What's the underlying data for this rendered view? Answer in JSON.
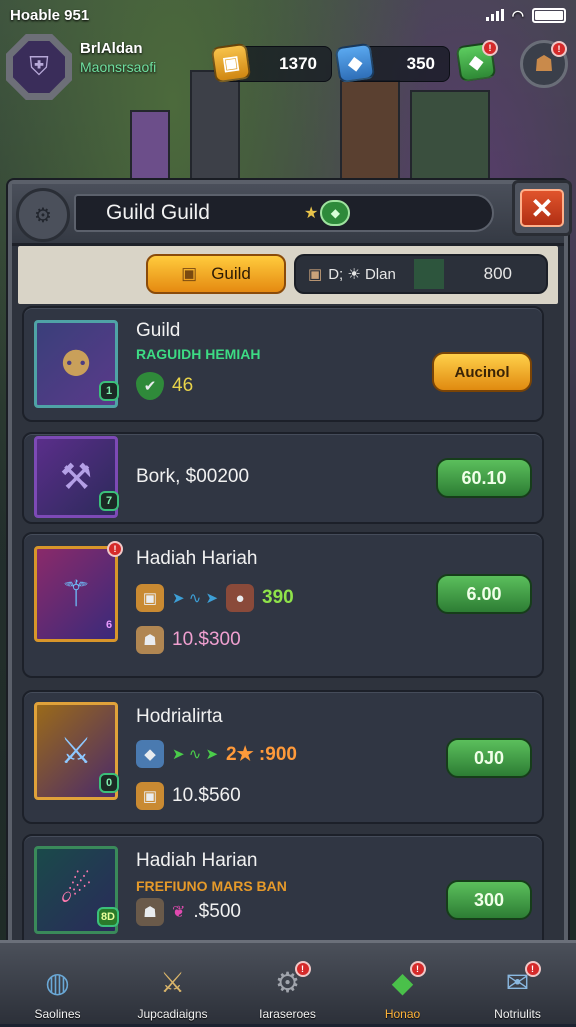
{
  "status_bar": {
    "time": "Hoable 951"
  },
  "player": {
    "name": "BrlAldan",
    "title": "Maonsrsaofi"
  },
  "resources": [
    {
      "value": "1370",
      "icon": "gold-crate-icon",
      "color": "#e8a22a"
    },
    {
      "value": "350",
      "icon": "blue-gem-icon",
      "color": "#3d8ad6"
    },
    {
      "value": "",
      "icon": "green-gem-icon",
      "color": "#3ea54a",
      "badge": "!"
    }
  ],
  "panel": {
    "title": "Guild Guild",
    "guild_tab": "Guild",
    "info_label": "D; ☀ Dlan",
    "info_count": "800"
  },
  "rows": [
    {
      "name": "Guild",
      "subtitle": "RAGUIDH HEMIAH",
      "subtitle_color": "#3ddc84",
      "value": "46",
      "button": "Aucinol",
      "button_style": "gold",
      "badge": "1"
    },
    {
      "name": "Bork, $00200",
      "button": "60.10",
      "button_style": "green",
      "badge": "7"
    },
    {
      "name": "Hadiah Hariah",
      "stat_a": "390",
      "stat_b": "10.$300",
      "button": "6.00",
      "button_style": "green",
      "badge": "6"
    },
    {
      "name": "Hodrialirta",
      "stat_a": "2★ :900",
      "stat_b": "10.$560",
      "button": "0J0",
      "button_style": "green",
      "badge": "0"
    },
    {
      "name": "Hadiah Harian",
      "subtitle": "FREFIUNO MARS BAN",
      "subtitle_color": "#e69a2a",
      "stat_b": ".$500",
      "button": "300",
      "button_style": "green",
      "badge": "8D"
    }
  ],
  "nav": [
    {
      "label": "Saolines",
      "icon": "shield-icon"
    },
    {
      "label": "Jupcadiaigns",
      "icon": "crossed-swords-icon"
    },
    {
      "label": "Iaraseroes",
      "icon": "cannon-icon",
      "badge": "!"
    },
    {
      "label": "Honao",
      "icon": "green-gem-icon",
      "badge": "!",
      "active": true
    },
    {
      "label": "Notriulits",
      "icon": "scroll-icon",
      "badge": "!"
    }
  ]
}
